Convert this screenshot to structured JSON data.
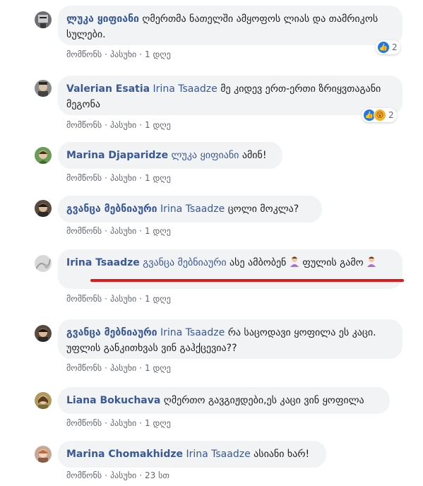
{
  "common": {
    "like_label": "მომწონს",
    "reply_label": "პასუხი",
    "dot": "·"
  },
  "comments": [
    {
      "author": "ლუკა ყიფიანი",
      "mention": "",
      "text": "ღმერთმა ნათელში ამყოფოს ლიას და თამრიკოს სულები.",
      "time": "1 დღე",
      "reactions": {
        "count": "2",
        "types": [
          "like"
        ]
      }
    },
    {
      "author": "Valerian Esatia",
      "mention": "Irina Tsaadze",
      "text": "მე კიდევ ერთ-ერთი ზრიყვთაგანი მეგონა",
      "time": "1 დღე",
      "reactions": {
        "count": "2",
        "types": [
          "like",
          "wow"
        ]
      }
    },
    {
      "author": "Marina Djaparidze",
      "mention": "ლუკა ყიფიანი",
      "text": "ამინ!",
      "time": "1 დღე"
    },
    {
      "author": "გვანცა მებნიაური",
      "mention": "Irina Tsaadze",
      "text": "ცოლი მოკლა?",
      "time": "1 დღე"
    },
    {
      "author": "Irina Tsaadze",
      "mention": "გვანცა მებნიაური",
      "text_a": "ასე ამბობენ",
      "text_b": "ფულის გამო",
      "time": "1 დღე"
    },
    {
      "author": "გვანცა მებნიაური",
      "mention": "Irina Tsaadze",
      "text": "რა საცოდავი ყოფილა ეს კაცი. უფლის განკითხვას ვინ გაჰქცევია??",
      "time": "1 დღე"
    },
    {
      "author": "Liana Bokuchava",
      "mention": "",
      "text": "ღმერთო გავგიჟდები,ეს კაცი ვინ ყოფილა",
      "time": "1 დღე"
    },
    {
      "author": "Marina Chomakhidze",
      "mention": "Irina Tsaadze",
      "text": "ასიანი ხარ!",
      "time": "23 სთ"
    }
  ]
}
